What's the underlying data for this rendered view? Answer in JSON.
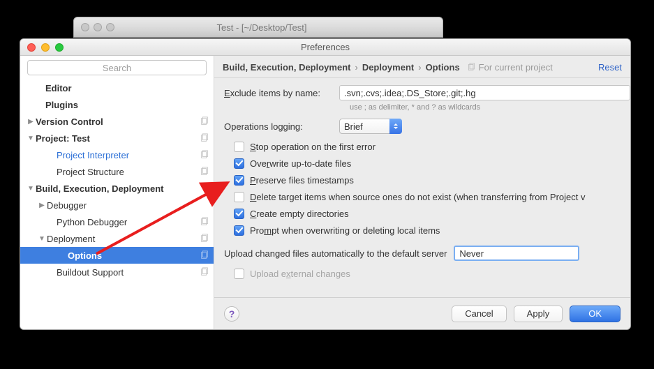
{
  "bgWindow": {
    "title": "Test - [~/Desktop/Test]"
  },
  "window": {
    "title": "Preferences"
  },
  "search": {
    "placeholder": "Search"
  },
  "sidebar": {
    "items": [
      {
        "label": "Editor"
      },
      {
        "label": "Plugins"
      },
      {
        "label": "Version Control"
      },
      {
        "label": "Project: Test"
      },
      {
        "label": "Project Interpreter"
      },
      {
        "label": "Project Structure"
      },
      {
        "label": "Build, Execution, Deployment"
      },
      {
        "label": "Debugger"
      },
      {
        "label": "Python Debugger"
      },
      {
        "label": "Deployment"
      },
      {
        "label": "Options"
      },
      {
        "label": "Buildout Support"
      }
    ]
  },
  "breadcrumb": {
    "a": "Build, Execution, Deployment",
    "b": "Deployment",
    "c": "Options",
    "forProject": "For current project",
    "reset": "Reset"
  },
  "form": {
    "excludeLabelPrefix": "E",
    "excludeLabelRest": "xclude items by name:",
    "excludeValue": ".svn;.cvs;.idea;.DS_Store;.git;.hg",
    "excludeHint": "use ; as delimiter, * and ? as wildcards",
    "opsLoggingLabel": "Operations logging:",
    "opsLoggingValue": "Brief",
    "checks": [
      {
        "pre": "S",
        "rest": "top operation on the first error",
        "checked": false
      },
      {
        "pre": "Ove",
        "u": "r",
        "rest": "write up-to-date files",
        "checked": true
      },
      {
        "pre": "P",
        "rest": "reserve files timestamps",
        "checked": true,
        "uFirst": true
      },
      {
        "pre": "D",
        "rest": "elete target items when source ones do not exist (when transferring from Project v",
        "checked": false,
        "uFirst": true
      },
      {
        "pre": "C",
        "rest": "reate empty directories",
        "checked": true,
        "uFirst": true
      },
      {
        "pre": "Pro",
        "u": "m",
        "rest": "pt when overwriting or deleting local items",
        "checked": true
      }
    ],
    "uploadLabel": "Upload changed files automatically to the default server",
    "uploadValue": "Never",
    "uploadExternalPre": "Upload e",
    "uploadExternalU": "x",
    "uploadExternalRest": "ternal changes"
  },
  "footer": {
    "cancel": "Cancel",
    "apply": "Apply",
    "ok": "OK"
  }
}
